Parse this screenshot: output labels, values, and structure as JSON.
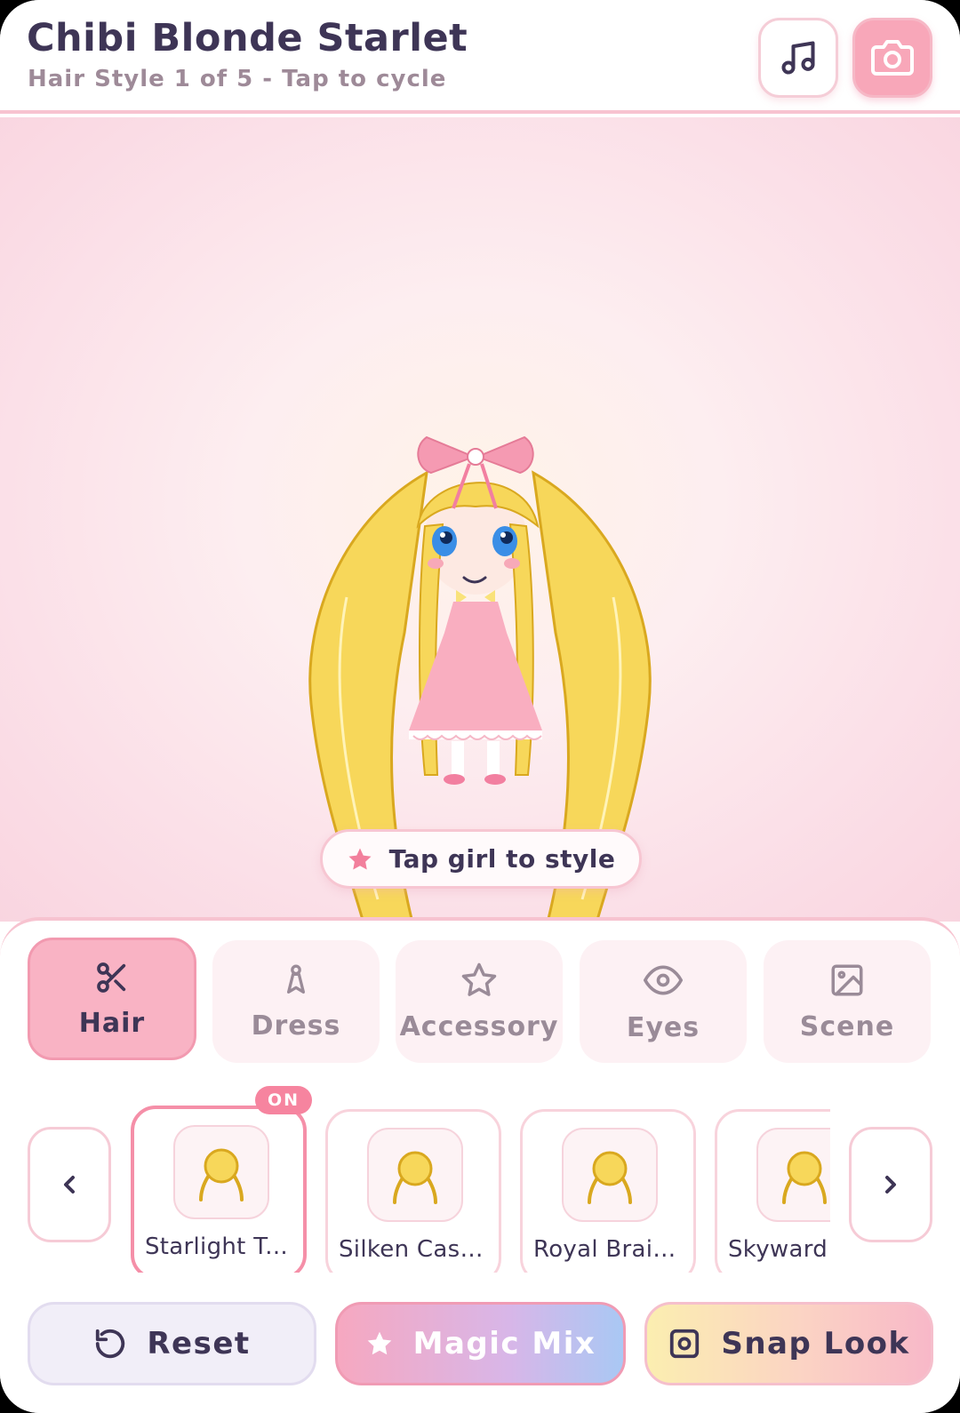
{
  "header": {
    "title": "Chibi Blonde Starlet",
    "subtitle": "Hair Style 1 of 5 - Tap to cycle",
    "music_icon": "music-note-icon",
    "camera_icon": "camera-icon"
  },
  "stage": {
    "hint_text": "Tap girl to style",
    "hint_icon": "star-icon"
  },
  "tabs": [
    {
      "label": "Hair",
      "icon": "scissors-icon",
      "active": true
    },
    {
      "label": "Dress",
      "icon": "dress-icon",
      "active": false
    },
    {
      "label": "Accessory",
      "icon": "star-outline-icon",
      "active": false
    },
    {
      "label": "Eyes",
      "icon": "eye-icon",
      "active": false
    },
    {
      "label": "Scene",
      "icon": "image-icon",
      "active": false
    }
  ],
  "styles": {
    "items": [
      {
        "name": "Starlight T...",
        "selected": true
      },
      {
        "name": "Silken Casc...",
        "selected": false
      },
      {
        "name": "Royal Braid...",
        "selected": false
      },
      {
        "name": "Skyward",
        "selected": false
      }
    ],
    "on_badge": "ON"
  },
  "actions": {
    "reset_label": "Reset",
    "magic_label": "Magic Mix",
    "snap_label": "Snap Look"
  },
  "colors": {
    "accent_pink": "#f9b3c4",
    "hair_yellow": "#f7d75a",
    "text_dark": "#3e3556"
  }
}
